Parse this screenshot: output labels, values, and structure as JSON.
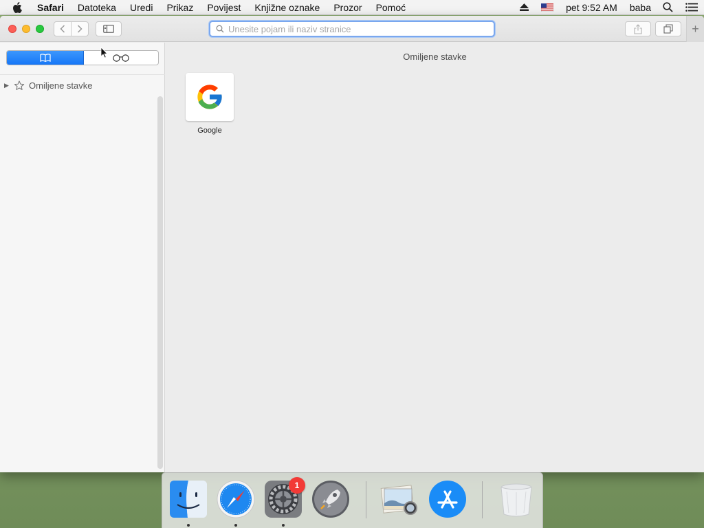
{
  "menubar": {
    "app_name": "Safari",
    "items": [
      "Datoteka",
      "Uredi",
      "Prikaz",
      "Povijest",
      "Knjižne oznake",
      "Prozor",
      "Pomoć"
    ],
    "clock": "pet 9:52 AM",
    "user": "baba"
  },
  "toolbar": {
    "address_placeholder": "Unesite pojam ili naziv stranice",
    "new_tab_label": "+"
  },
  "sidebar": {
    "row_label": "Omiljene stavke"
  },
  "content": {
    "heading": "Omiljene stavke",
    "favorites": [
      {
        "label": "Google"
      }
    ]
  },
  "dock": {
    "items": [
      {
        "name": "Finder",
        "running": true
      },
      {
        "name": "Safari",
        "running": true
      },
      {
        "name": "System Preferences",
        "running": true,
        "badge": "1"
      },
      {
        "name": "Launchpad",
        "running": false
      },
      {
        "name": "Preview",
        "running": false
      },
      {
        "name": "App Store",
        "running": false
      },
      {
        "name": "Trash",
        "running": false
      }
    ]
  },
  "colors": {
    "accent": "#1677f7",
    "badge": "#f23a36"
  }
}
